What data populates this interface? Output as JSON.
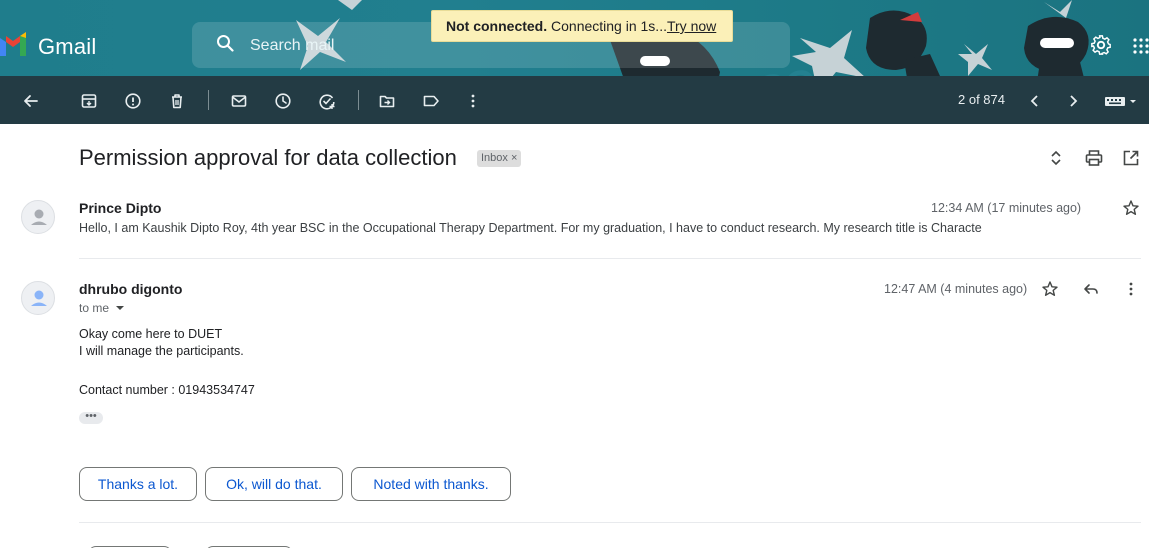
{
  "app": {
    "name": "Gmail"
  },
  "search": {
    "placeholder": "Search mail"
  },
  "banner": {
    "status": "Not connected.",
    "message": " Connecting in 1s...",
    "action": "Try now"
  },
  "toolbar": {
    "pagination": "2 of 874"
  },
  "thread": {
    "subject": "Permission approval for data collection",
    "label": "Inbox",
    "label_remove": "×"
  },
  "messages": [
    {
      "sender": "Prince Dipto",
      "time": "12:34 AM (17 minutes ago)",
      "snippet": "Hello, I am Kaushik Dipto Roy, 4th year BSC in the Occupational Therapy Department. For my graduation, I have to conduct research. My research title is Characte"
    },
    {
      "sender": "dhrubo digonto",
      "recipient": "to me",
      "time": "12:47 AM (4 minutes ago)",
      "body": [
        "Okay come here to DUET",
        "I will manage the participants.",
        "Contact number : 01943534747"
      ],
      "trimmed": "•••"
    }
  ],
  "smart_replies": [
    "Thanks a lot.",
    "Ok, will do that.",
    "Noted with thanks."
  ],
  "colors": {
    "header_bg": "#1f7d8c",
    "toolbar_bg": "#233b44",
    "banner_bg": "#fbf0b8",
    "link_blue": "#0b57d0"
  }
}
